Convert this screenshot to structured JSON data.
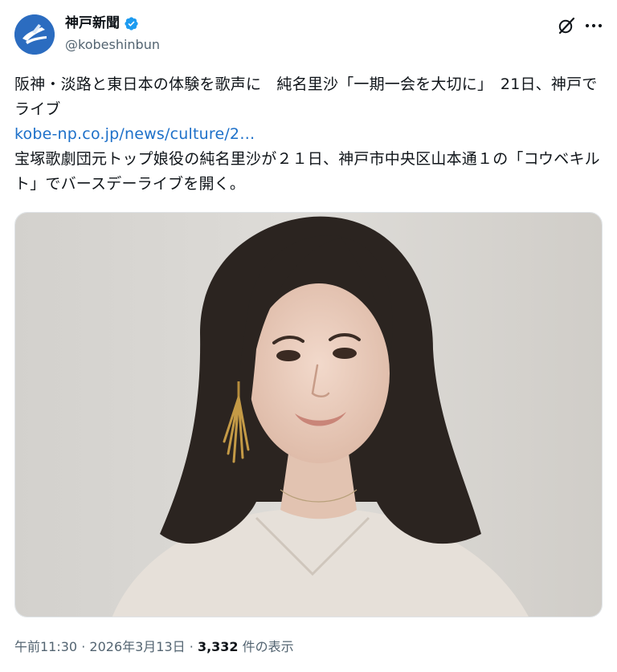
{
  "account": {
    "display_name": "神戸新聞",
    "handle": "@kobeshinbun",
    "verified": true,
    "brand_color": "#2b6cc0",
    "verified_color": "#1d9bf0"
  },
  "icons": {
    "grok": "grok-icon",
    "more": "more-icon",
    "verified": "verified-badge-icon",
    "avatar": "kobe-shinbun-logo"
  },
  "post": {
    "headline": "阪神・淡路と東日本の体験を歌声に　純名里沙「一期一会を大切に」　21日、神戸でライブ",
    "link_text": "kobe-np.co.jp/news/culture/2…",
    "body": "宝塚歌劇団元トップ娘役の純名里沙が２１日、神戸市中央区山本通１の「コウベキルト」でバースデーライブを開く。",
    "link_color": "#1d70c9"
  },
  "meta": {
    "time": "午前11:30",
    "date": "2026年3月13日",
    "separator": "·",
    "views_count": "3,332",
    "views_label": "件の表示"
  }
}
